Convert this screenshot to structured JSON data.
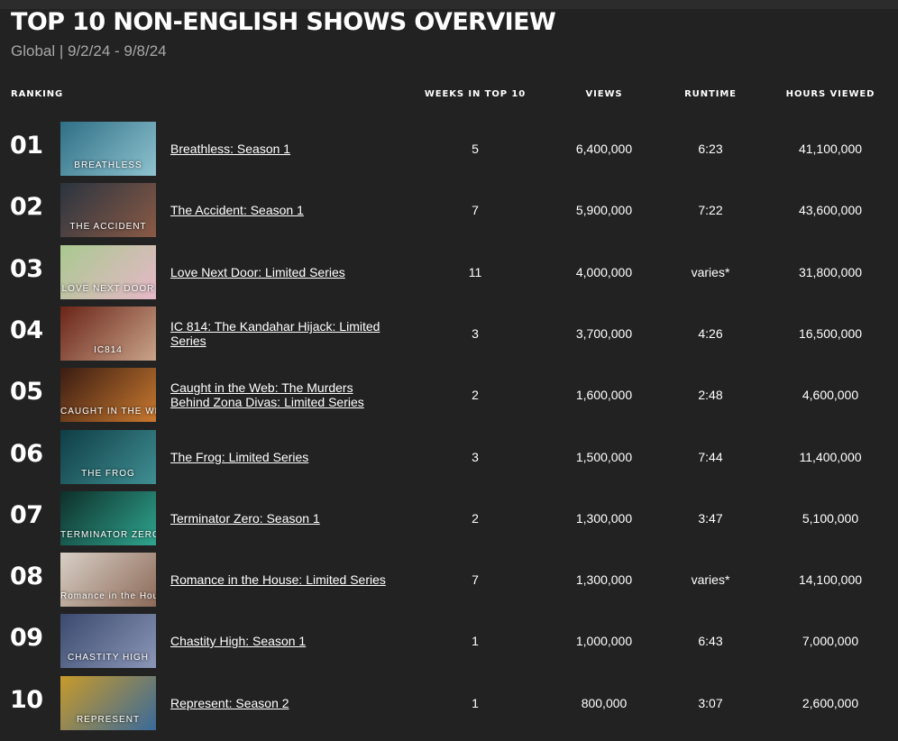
{
  "page": {
    "title": "TOP 10 NON-ENGLISH SHOWS OVERVIEW",
    "subtitle": "Global | 9/2/24 - 9/8/24"
  },
  "headers": {
    "ranking": "RANKING",
    "weeks": "WEEKS IN TOP 10",
    "views": "VIEWS",
    "runtime": "RUNTIME",
    "hours": "HOURS VIEWED"
  },
  "rows": [
    {
      "rank": "01",
      "title": "Breathless: Season 1",
      "weeks": "5",
      "views": "6,400,000",
      "runtime": "6:23",
      "hours": "41,100,000",
      "thumb_text": "BREATHLESS",
      "thumb_colors": [
        "#2f6f86",
        "#8fc3cf"
      ]
    },
    {
      "rank": "02",
      "title": "The Accident: Season 1",
      "weeks": "7",
      "views": "5,900,000",
      "runtime": "7:22",
      "hours": "43,600,000",
      "thumb_text": "THE ACCIDENT",
      "thumb_colors": [
        "#2a3440",
        "#8a5a45"
      ]
    },
    {
      "rank": "03",
      "title": "Love Next Door: Limited Series",
      "weeks": "11",
      "views": "4,000,000",
      "runtime": "varies*",
      "hours": "31,800,000",
      "thumb_text": "LOVE NEXT DOOR",
      "thumb_colors": [
        "#a9c98f",
        "#e6b7c8"
      ]
    },
    {
      "rank": "04",
      "title": "IC 814: The Kandahar Hijack: Limited Series",
      "weeks": "3",
      "views": "3,700,000",
      "runtime": "4:26",
      "hours": "16,500,000",
      "thumb_text": "IC814",
      "thumb_colors": [
        "#6a2418",
        "#c9a48a"
      ]
    },
    {
      "rank": "05",
      "title": "Caught in the Web: The Murders Behind Zona Divas: Limited Series",
      "weeks": "2",
      "views": "1,600,000",
      "runtime": "2:48",
      "hours": "4,600,000",
      "thumb_text": "CAUGHT IN THE WEB",
      "thumb_colors": [
        "#3a1c12",
        "#c9792f"
      ]
    },
    {
      "rank": "06",
      "title": "The Frog: Limited Series",
      "weeks": "3",
      "views": "1,500,000",
      "runtime": "7:44",
      "hours": "11,400,000",
      "thumb_text": "THE FROG",
      "thumb_colors": [
        "#0f3d45",
        "#3f8f93"
      ]
    },
    {
      "rank": "07",
      "title": "Terminator Zero: Season 1",
      "weeks": "2",
      "views": "1,300,000",
      "runtime": "3:47",
      "hours": "5,100,000",
      "thumb_text": "TERMINATOR ZERO",
      "thumb_colors": [
        "#0e2f2a",
        "#2fa58f"
      ]
    },
    {
      "rank": "08",
      "title": "Romance in the House: Limited Series",
      "weeks": "7",
      "views": "1,300,000",
      "runtime": "varies*",
      "hours": "14,100,000",
      "thumb_text": "Romance in the House",
      "thumb_colors": [
        "#d8cfc6",
        "#8c6a58"
      ]
    },
    {
      "rank": "09",
      "title": "Chastity High: Season 1",
      "weeks": "1",
      "views": "1,000,000",
      "runtime": "6:43",
      "hours": "7,000,000",
      "thumb_text": "CHASTITY HIGH",
      "thumb_colors": [
        "#3a4a6e",
        "#8c97b8"
      ]
    },
    {
      "rank": "10",
      "title": "Represent: Season 2",
      "weeks": "1",
      "views": "800,000",
      "runtime": "3:07",
      "hours": "2,600,000",
      "thumb_text": "REPRESENT",
      "thumb_colors": [
        "#c89a2a",
        "#3a6a9a"
      ]
    }
  ]
}
